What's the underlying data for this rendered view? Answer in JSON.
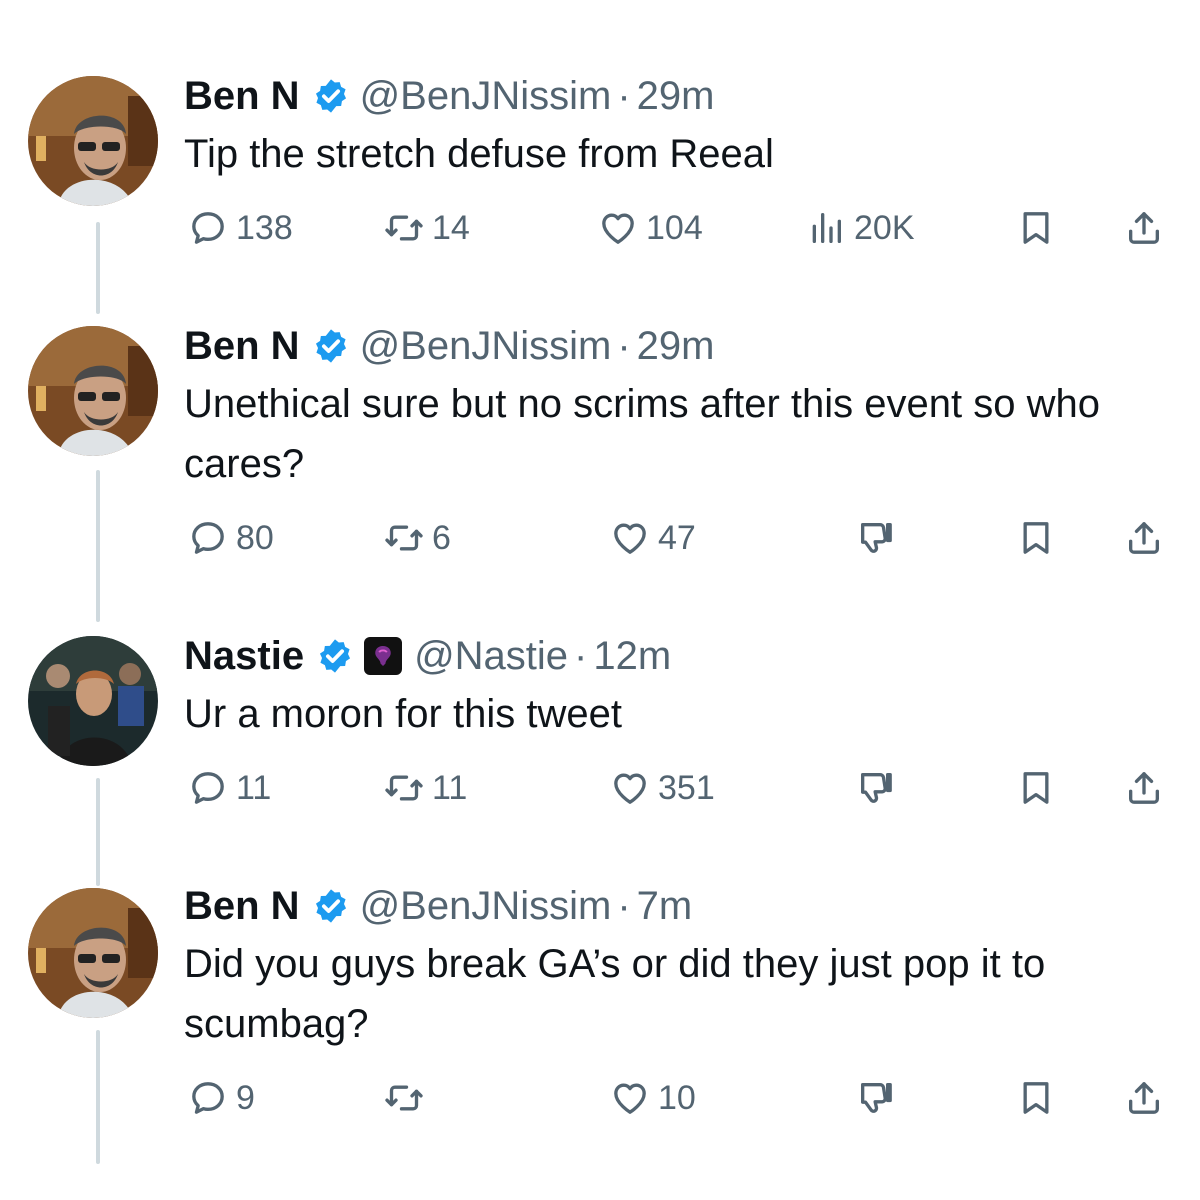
{
  "tweets": [
    {
      "name": "Ben N",
      "handle": "@BenJNissim",
      "separator": "·",
      "time": "29m",
      "text": "Tip the stretch defuse from Reeal",
      "replies": "138",
      "retweets": "14",
      "likes": "104",
      "views": "20K"
    },
    {
      "name": "Ben N",
      "handle": "@BenJNissim",
      "separator": "·",
      "time": "29m",
      "text": "Unethical sure but no scrims after this event so who cares?",
      "replies": "80",
      "retweets": "6",
      "likes": "47"
    },
    {
      "name": "Nastie",
      "handle": "@Nastie",
      "separator": "·",
      "time": "12m",
      "text": "Ur a moron for this tweet",
      "replies": "11",
      "retweets": "11",
      "likes": "351"
    },
    {
      "name": "Ben N",
      "handle": "@BenJNissim",
      "separator": "·",
      "time": "7m",
      "text": "Did you guys break GA’s or did they just pop it to scumbag?",
      "replies": "9",
      "retweets": "",
      "likes": "10"
    }
  ],
  "icons": {
    "reply": "reply-icon",
    "retweet": "retweet-icon",
    "like": "heart-icon",
    "views": "views-icon",
    "dislike": "dislike-icon",
    "bookmark": "bookmark-icon",
    "share": "share-icon",
    "verified": "verified-badge-icon"
  },
  "colors": {
    "verified": "#1d9bf0",
    "secondary_text": "#536471",
    "primary_text": "#0f1419",
    "thread_line": "#cfd9de"
  }
}
